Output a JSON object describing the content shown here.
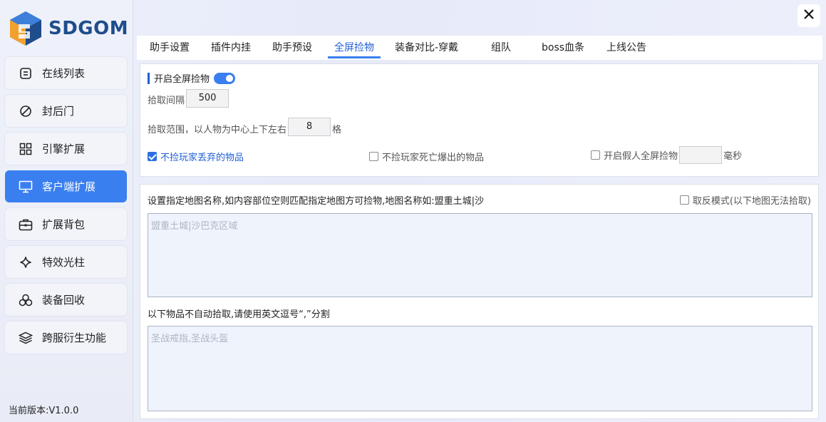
{
  "brand": {
    "name": "SDGOM"
  },
  "sidebar": {
    "items": [
      {
        "label": "在线列表",
        "icon": "list-icon"
      },
      {
        "label": "封后门",
        "icon": "ban-icon"
      },
      {
        "label": "引擎扩展",
        "icon": "grid-icon"
      },
      {
        "label": "客户端扩展",
        "icon": "monitor-icon",
        "active": true
      },
      {
        "label": "扩展背包",
        "icon": "briefcase-icon"
      },
      {
        "label": "特效光柱",
        "icon": "sparkle-icon"
      },
      {
        "label": "装备回收",
        "icon": "recycle-icon"
      },
      {
        "label": "跨服衍生功能",
        "icon": "layers-icon"
      }
    ],
    "version": "当前版本:V1.0.0"
  },
  "tabs": [
    {
      "label": "助手设置"
    },
    {
      "label": "插件内挂"
    },
    {
      "label": "助手预设"
    },
    {
      "label": "全屏捡物",
      "active": true
    },
    {
      "label": "装备对比-穿戴"
    },
    {
      "label": "组队"
    },
    {
      "label": "boss血条"
    },
    {
      "label": "上线公告"
    }
  ],
  "pickup": {
    "enable_label": "开启全屏捡物",
    "enabled": true,
    "interval_label": "拾取间隔",
    "interval_value": "500",
    "range_label": "拾取范围，以人物为中心上下左右",
    "range_value": "8",
    "range_unit": "格",
    "opt1_label": "不捡玩家丢弃的物品",
    "opt1_checked": true,
    "opt2_label": "不捡玩家死亡爆出的物品",
    "opt2_checked": false,
    "opt3_label": "开启假人全屏捡物",
    "opt3_checked": false,
    "opt3_unit": "毫秒"
  },
  "maps": {
    "label": "设置指定地图名称,如内容部位空则匹配指定地图方可捡物,地图名称如:盟重土城|沙",
    "invert_label": "取反模式(以下地图无法拾取)",
    "invert_checked": false,
    "placeholder": "盟重土城|沙巴克区域"
  },
  "exclude": {
    "label": "以下物品不自动拾取,请使用英文逗号“,”分割",
    "placeholder": "圣战戒指,圣战头盔"
  },
  "colors": {
    "accent": "#3a7ff0",
    "accent_text": "#1f5fd6"
  }
}
